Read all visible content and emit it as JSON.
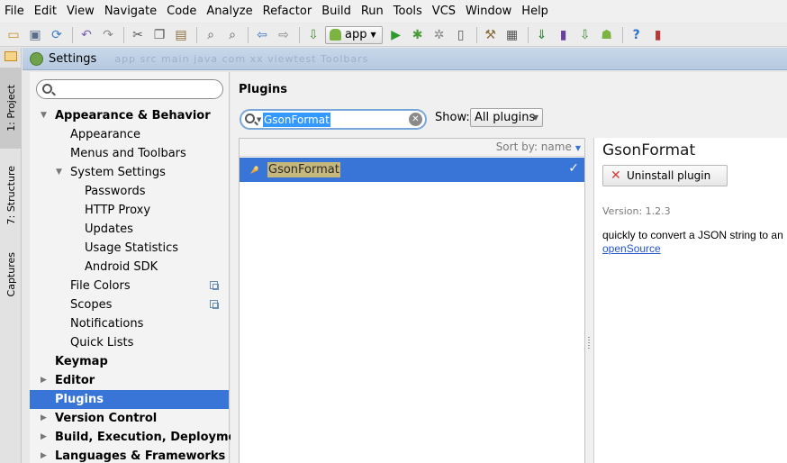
{
  "menu": [
    "File",
    "Edit",
    "View",
    "Navigate",
    "Code",
    "Analyze",
    "Refactor",
    "Build",
    "Run",
    "Tools",
    "VCS",
    "Window",
    "Help"
  ],
  "toolbar": {
    "run_config": "app"
  },
  "tool_windows": {
    "project": "1: Project",
    "structure": "7: Structure",
    "captures": "Captures"
  },
  "dialog": {
    "title": "Settings",
    "breadcrumb_blur": "app   src   main   java   com   xx   viewtest   Toolbars"
  },
  "tree": [
    {
      "label": "Appearance & Behavior",
      "level": 0,
      "expanded": true,
      "bold": true
    },
    {
      "label": "Appearance",
      "level": 1
    },
    {
      "label": "Menus and Toolbars",
      "level": 1
    },
    {
      "label": "System Settings",
      "level": 1,
      "expanded": true
    },
    {
      "label": "Passwords",
      "level": 2
    },
    {
      "label": "HTTP Proxy",
      "level": 2
    },
    {
      "label": "Updates",
      "level": 2
    },
    {
      "label": "Usage Statistics",
      "level": 2
    },
    {
      "label": "Android SDK",
      "level": 2
    },
    {
      "label": "File Colors",
      "level": 1,
      "copy_icon": true
    },
    {
      "label": "Scopes",
      "level": 1,
      "copy_icon": true
    },
    {
      "label": "Notifications",
      "level": 1
    },
    {
      "label": "Quick Lists",
      "level": 1
    },
    {
      "label": "Keymap",
      "level": 0,
      "bold": true
    },
    {
      "label": "Editor",
      "level": 0,
      "collapsed": true,
      "bold": true
    },
    {
      "label": "Plugins",
      "level": 0,
      "bold": true,
      "selected": true
    },
    {
      "label": "Version Control",
      "level": 0,
      "collapsed": true,
      "bold": true
    },
    {
      "label": "Build, Execution, Deployment",
      "level": 0,
      "collapsed": true,
      "bold": true
    },
    {
      "label": "Languages & Frameworks",
      "level": 0,
      "collapsed": true,
      "bold": true
    }
  ],
  "plugins": {
    "title": "Plugins",
    "search_value": "GsonFormat",
    "show_label": "Show:",
    "show_value": "All plugins",
    "sort_label": "Sort by: name",
    "list": [
      {
        "name": "GsonFormat",
        "enabled": true
      }
    ],
    "detail": {
      "name": "GsonFormat",
      "uninstall_label": "Uninstall plugin",
      "version": "Version: 1.2.3",
      "description": "quickly to convert a JSON string to an",
      "link": "openSource"
    }
  },
  "colors": {
    "selection": "#3875d7",
    "search_highlight": "#c6b77c",
    "link": "#2255cc",
    "title_bar": "#c8d8ea"
  }
}
